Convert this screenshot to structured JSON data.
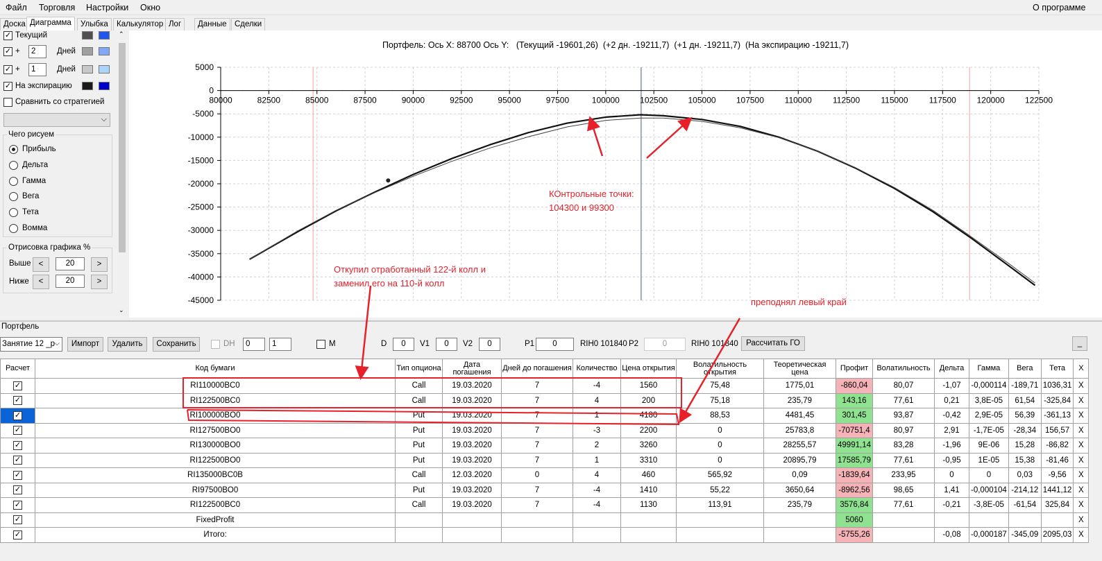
{
  "menu": [
    "Файл",
    "Торговля",
    "Настройки",
    "Окно"
  ],
  "about": "О программе",
  "tabs": [
    "Доска",
    "Диаграмма",
    "Улыбка",
    "Калькулятор",
    "Лог",
    "Данные",
    "Сделки"
  ],
  "left": {
    "current_label": "Текущий",
    "plus": "+",
    "days_label": "Дней",
    "days1": "2",
    "days2": "1",
    "expiry_label": "На экспирацию",
    "compare_label": "Сравнить со стратегией",
    "draw_group": "Чего рисуем",
    "radios": [
      "Прибыль",
      "Дельта",
      "Гамма",
      "Вега",
      "Тета",
      "Вомма"
    ],
    "draw_pct_group": "Отрисовка графика %",
    "above": "Выше",
    "below": "Ниже",
    "above_val": "20",
    "below_val": "20",
    "left_arrow": "<",
    "right_arrow": ">",
    "colors": {
      "current": [
        "#505050",
        "#2255ee"
      ],
      "plus2": [
        "#a0a0a0",
        "#7fa8f8"
      ],
      "plus1": [
        "#c8c8c8",
        "#aad4fb"
      ],
      "expiry": [
        "#1a1a1a",
        "#0000cc"
      ]
    }
  },
  "chart_header": "Портфель: Ось X: 88700 Ось Y:   (Текущий -19601,26)  (+2 дн. -19211,7)  (+1 дн. -19211,7)  (На экспирацию -19211,7)",
  "chart_data": {
    "type": "line",
    "xlim": [
      80000,
      122500
    ],
    "ylim": [
      -45000,
      5000
    ],
    "xticks": [
      "80000",
      "82500",
      "85000",
      "87500",
      "90000",
      "92500",
      "95000",
      "97500",
      "100000",
      "102500",
      "105000",
      "107500",
      "110000",
      "112500",
      "115000",
      "117500",
      "120000",
      "122500"
    ],
    "yticks": [
      "5000",
      "0",
      "-5000",
      "-10000",
      "-15000",
      "-20000",
      "-25000",
      "-30000",
      "-35000",
      "-40000",
      "-45000"
    ],
    "xtick_values": [
      80000,
      82500,
      85000,
      87500,
      90000,
      92500,
      95000,
      97500,
      100000,
      102500,
      105000,
      107500,
      110000,
      112500,
      115000,
      117500,
      120000,
      122500
    ],
    "ytick_values": [
      5000,
      0,
      -5000,
      -10000,
      -15000,
      -20000,
      -25000,
      -30000,
      -35000,
      -40000,
      -45000
    ],
    "cursor_x": 101840,
    "red_lines_x": [
      84800,
      118900
    ],
    "marker": {
      "x": 88700,
      "y": -19300
    },
    "series": [
      {
        "x": [
          81500,
          84000,
          86000,
          88000,
          90000,
          92000,
          94000,
          96000,
          98000,
          100000,
          101800,
          103000,
          105000,
          107000,
          109000,
          111000,
          113000,
          115000,
          117000,
          119000,
          121000,
          122300
        ],
        "y": [
          -36200,
          -30300,
          -25800,
          -21800,
          -18000,
          -14600,
          -11600,
          -9000,
          -7000,
          -5700,
          -5200,
          -5400,
          -6200,
          -7700,
          -10000,
          -13000,
          -16700,
          -21000,
          -26000,
          -31700,
          -37800,
          -41800
        ]
      },
      {
        "x": [
          81500,
          84000,
          86000,
          88000,
          90000,
          92000,
          94000,
          96000,
          98000,
          100000,
          101800,
          103000,
          105000,
          107000,
          109000,
          111000,
          113000,
          115000,
          117000,
          119000,
          121000,
          122300
        ],
        "y": [
          -36200,
          -30100,
          -25700,
          -21900,
          -18400,
          -15200,
          -12300,
          -9900,
          -7800,
          -6400,
          -5900,
          -5900,
          -6600,
          -8000,
          -10100,
          -13000,
          -16600,
          -20800,
          -25700,
          -31400,
          -37300,
          -41300
        ]
      }
    ]
  },
  "annotations": {
    "control": [
      "КОнтрольные точки:",
      "104300 и 99300"
    ],
    "buyback": [
      "Откупил отработанный 122-й колл и",
      "заменил его на 110-й колл"
    ],
    "raised": "преподнял левый край"
  },
  "portfolio": {
    "label": "Портфель",
    "session": "Занятие 12 _р",
    "import": "Импорт",
    "delete": "Удалить",
    "save": "Сохранить",
    "dh": "DH",
    "dh_val1": "0",
    "dh_val2": "1",
    "m": "М",
    "d": "D",
    "d_val": "0",
    "v1": "V1",
    "v1_val": "0",
    "v2": "V2",
    "v2_val": "0",
    "p1": "P1",
    "p1_val": "0",
    "rih1": "RIH0 101840",
    "p2": "P2",
    "p2_val": "0",
    "rih2": "RIH0 101840",
    "calc_go": "Рассчитать ГО",
    "min": "_"
  },
  "table": {
    "headers": [
      "Расчет",
      "Код бумаги",
      "Тип опциона",
      "Дата погашения",
      "Дней до погашения",
      "Количество",
      "Цена открытия",
      "Волатильность открытия",
      "Теоретическая цена",
      "Профит",
      "Волатильность",
      "Дельта",
      "Гамма",
      "Вега",
      "Тета",
      "X"
    ],
    "rows": [
      {
        "code": "RI110000BC0",
        "type": "Call",
        "date": "19.03.2020",
        "days": "7",
        "qty": "-4",
        "price": "1560",
        "vol_open": "75,48",
        "theo": "1775,01",
        "profit": "-860,04",
        "vol": "80,07",
        "delta": "-1,07",
        "gamma": "-0,000114",
        "vega": "-189,71",
        "theta": "1036,31",
        "x": "X",
        "sign": "neg"
      },
      {
        "code": "RI122500BC0",
        "type": "Call",
        "date": "19.03.2020",
        "days": "7",
        "qty": "4",
        "price": "200",
        "vol_open": "75,18",
        "theo": "235,79",
        "profit": "143,16",
        "vol": "77,61",
        "delta": "0,21",
        "gamma": "3,8E-05",
        "vega": "61,54",
        "theta": "-325,84",
        "x": "X",
        "sign": "pos"
      },
      {
        "code": "RI100000BO0",
        "type": "Put",
        "date": "19.03.2020",
        "days": "7",
        "qty": "1",
        "price": "4180",
        "vol_open": "88,53",
        "theo": "4481,45",
        "profit": "301,45",
        "vol": "93,87",
        "delta": "-0,42",
        "gamma": "2,9E-05",
        "vega": "56,39",
        "theta": "-361,13",
        "x": "X",
        "sign": "pos"
      },
      {
        "code": "RI127500BO0",
        "type": "Put",
        "date": "19.03.2020",
        "days": "7",
        "qty": "-3",
        "price": "2200",
        "vol_open": "0",
        "theo": "25783,8",
        "profit": "-70751,4",
        "vol": "80,97",
        "delta": "2,91",
        "gamma": "-1,7E-05",
        "vega": "-28,34",
        "theta": "156,57",
        "x": "X",
        "sign": "neg"
      },
      {
        "code": "RI130000BO0",
        "type": "Put",
        "date": "19.03.2020",
        "days": "7",
        "qty": "2",
        "price": "3260",
        "vol_open": "0",
        "theo": "28255,57",
        "profit": "49991,14",
        "vol": "83,28",
        "delta": "-1,96",
        "gamma": "9E-06",
        "vega": "15,28",
        "theta": "-86,82",
        "x": "X",
        "sign": "pos"
      },
      {
        "code": "RI122500BO0",
        "type": "Put",
        "date": "19.03.2020",
        "days": "7",
        "qty": "1",
        "price": "3310",
        "vol_open": "0",
        "theo": "20895,79",
        "profit": "17585,79",
        "vol": "77,61",
        "delta": "-0,95",
        "gamma": "1E-05",
        "vega": "15,38",
        "theta": "-81,46",
        "x": "X",
        "sign": "pos"
      },
      {
        "code": "RI135000BC0B",
        "type": "Call",
        "date": "12.03.2020",
        "days": "0",
        "qty": "4",
        "price": "460",
        "vol_open": "565,92",
        "theo": "0,09",
        "profit": "-1839,64",
        "vol": "233,95",
        "delta": "0",
        "gamma": "0",
        "vega": "0,03",
        "theta": "-9,56",
        "x": "X",
        "sign": "neg"
      },
      {
        "code": "RI97500BO0",
        "type": "Put",
        "date": "19.03.2020",
        "days": "7",
        "qty": "-4",
        "price": "1410",
        "vol_open": "55,22",
        "theo": "3650,64",
        "profit": "-8962,56",
        "vol": "98,65",
        "delta": "1,41",
        "gamma": "-0,000104",
        "vega": "-214,12",
        "theta": "1441,12",
        "x": "X",
        "sign": "neg"
      },
      {
        "code": "RI122500BC0",
        "type": "Call",
        "date": "19.03.2020",
        "days": "7",
        "qty": "-4",
        "price": "1130",
        "vol_open": "113,91",
        "theo": "235,79",
        "profit": "3576,84",
        "vol": "77,61",
        "delta": "-0,21",
        "gamma": "-3,8E-05",
        "vega": "-61,54",
        "theta": "325,84",
        "x": "X",
        "sign": "pos"
      },
      {
        "code": "FixedProfit",
        "type": "",
        "date": "",
        "days": "",
        "qty": "",
        "price": "",
        "vol_open": "",
        "theo": "",
        "profit": "5060",
        "vol": "",
        "delta": "",
        "gamma": "",
        "vega": "",
        "theta": "",
        "x": "X",
        "sign": "pos"
      },
      {
        "code": "Итого:",
        "type": "",
        "date": "",
        "days": "",
        "qty": "",
        "price": "",
        "vol_open": "",
        "theo": "",
        "profit": "-5755,26",
        "vol": "",
        "delta": "-0,08",
        "gamma": "-0,000187",
        "vega": "-345,09",
        "theta": "2095,03",
        "x": "X",
        "sign": "neg"
      }
    ]
  }
}
